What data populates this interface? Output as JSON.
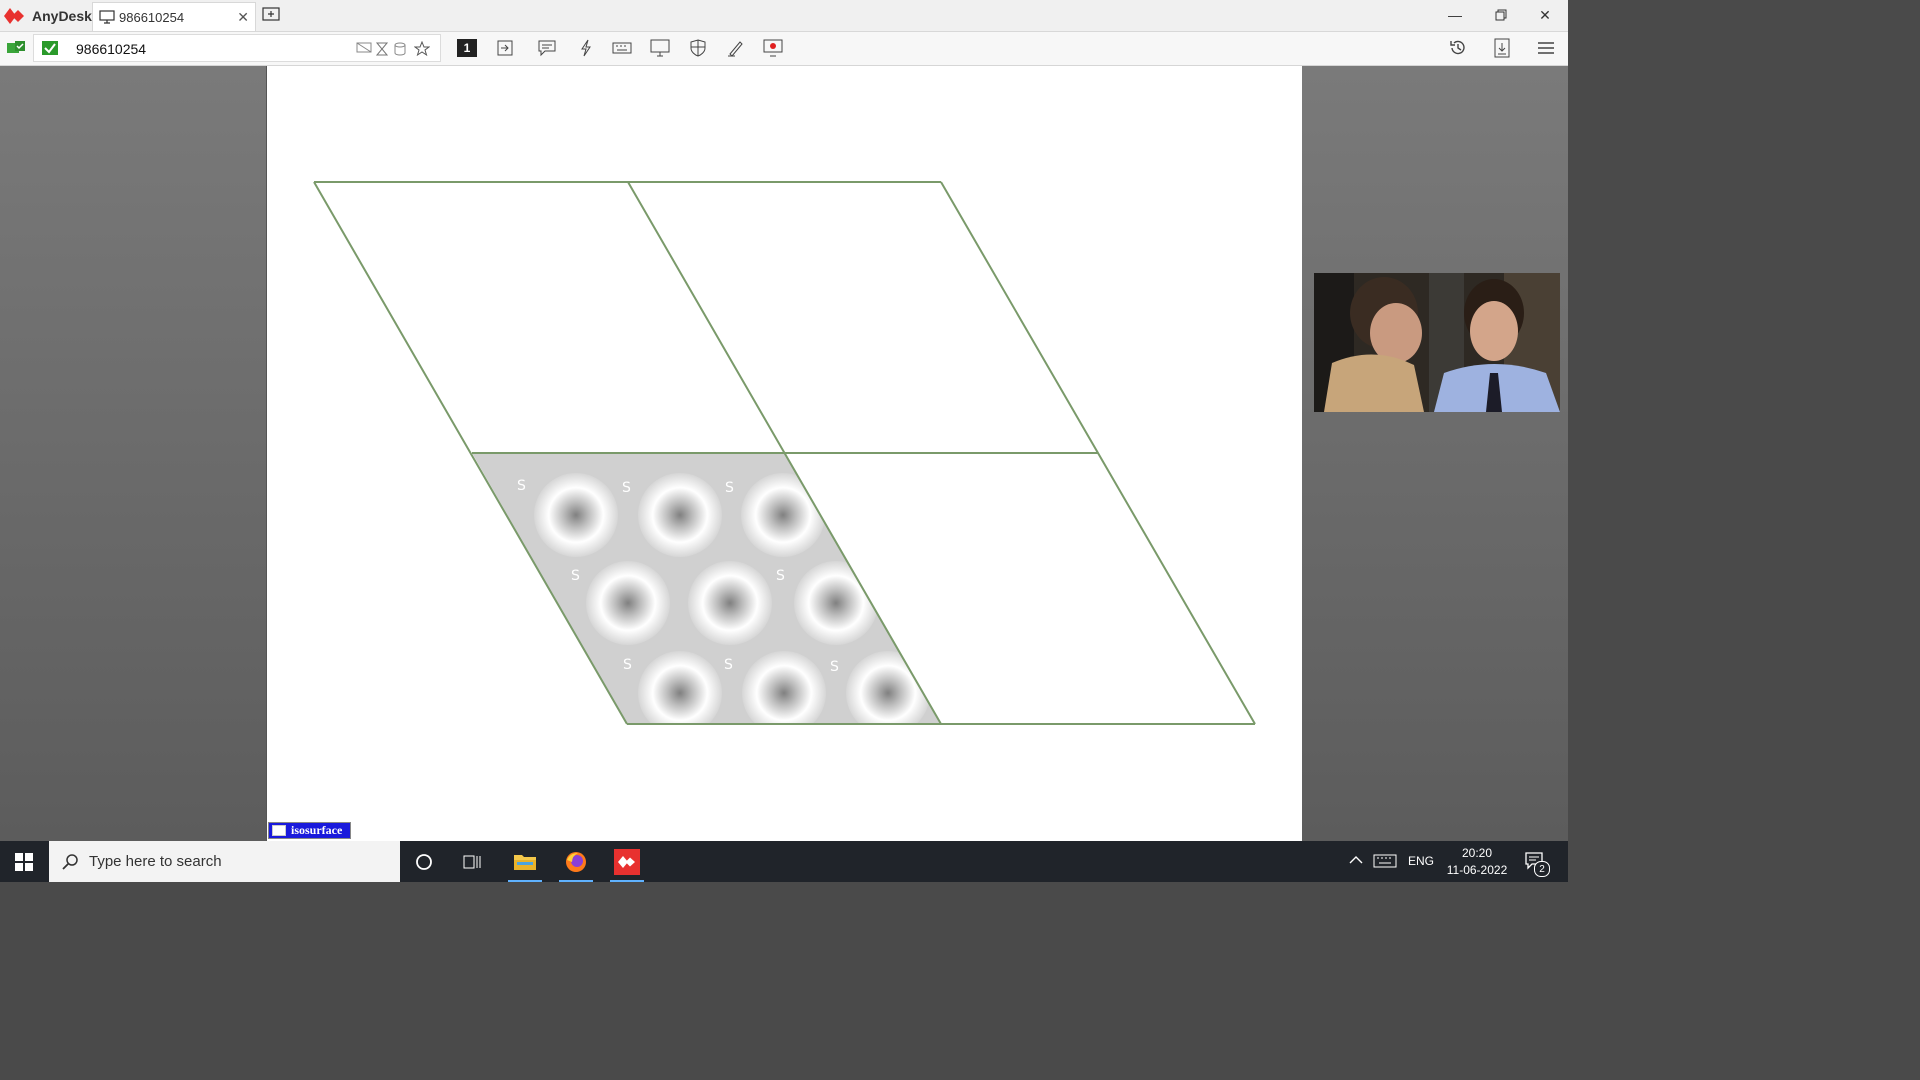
{
  "app": {
    "name": "AnyDesk"
  },
  "tab": {
    "label": "986610254"
  },
  "address": {
    "value": "986610254"
  },
  "toolbar": {
    "monitor_number": "1"
  },
  "remote": {
    "cell_letter": "S",
    "label": "isosurface"
  },
  "taskbar": {
    "search_placeholder": "Type here to search",
    "language": "ENG",
    "time": "20:20",
    "date": "11-06-2022",
    "notification_count": "2"
  },
  "colors": {
    "accent": "#e8312f",
    "grid_line": "#7a9a6a",
    "iso_label_bg": "#1a1adc",
    "taskbar": "#20242a"
  }
}
